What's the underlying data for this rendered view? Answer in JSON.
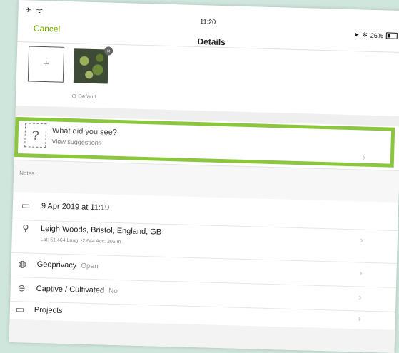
{
  "status_bar": {
    "left": "✈ ᯤ",
    "time": "11:20",
    "battery": "26%"
  },
  "nav": {
    "cancel": "Cancel",
    "title": "Details"
  },
  "photos": {
    "add": "+",
    "remove": "×",
    "default_label": "⊙ Default"
  },
  "species": {
    "title": "What did you see?",
    "subtitle": "View suggestions",
    "icon": "?"
  },
  "notes": {
    "placeholder": "Notes..."
  },
  "rows": {
    "date": {
      "text": "9 Apr 2019 at 11:19"
    },
    "location": {
      "text": "Leigh Woods, Bristol, England, GB",
      "coords": "Lat: 51.464  Long: -2.644  Acc: 206 m"
    },
    "geoprivacy": {
      "label": "Geoprivacy",
      "value": "Open"
    },
    "captive": {
      "label": "Captive / Cultivated",
      "value": "No"
    },
    "projects": {
      "label": "Projects"
    }
  },
  "colors": {
    "accent": "#74ac00",
    "highlight": "#8cc63f"
  }
}
